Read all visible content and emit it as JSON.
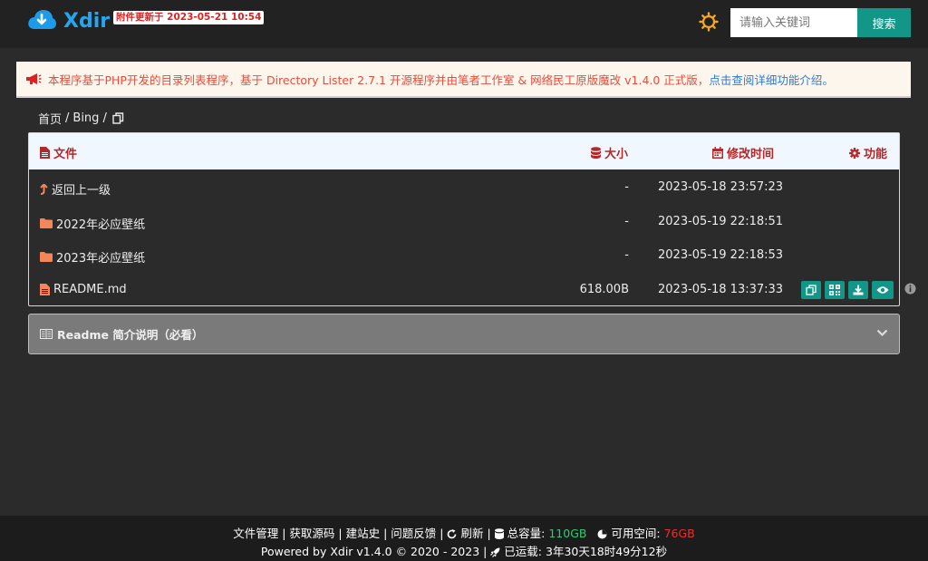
{
  "header": {
    "logo_text": "Xdir",
    "update_badge": "附件更新于 2023-05-21 10:54",
    "search": {
      "placeholder": "请输入关键词",
      "button": "搜索"
    }
  },
  "notice": {
    "text": "本程序基于PHP开发的目录列表程序，基于 Directory Lister 2.7.1 开源程序并由笔者工作室 & 网络民工原版魔改 v1.4.0 正式版，",
    "link": "点击查阅详细功能介绍。"
  },
  "breadcrumb": {
    "items": [
      "首页",
      "Bing"
    ],
    "separator": "/"
  },
  "table": {
    "columns": {
      "file": "文件",
      "size": "大小",
      "time": "修改时间",
      "func": "功能"
    },
    "rows": [
      {
        "name": "返回上一级",
        "icon": "up-arrow-icon",
        "size": "-",
        "time": "2023-05-18 23:57:23"
      },
      {
        "name": "2022年必应壁纸",
        "icon": "folder-icon",
        "size": "-",
        "time": "2023-05-19 22:18:51"
      },
      {
        "name": "2023年必应壁纸",
        "icon": "folder-icon",
        "size": "-",
        "time": "2023-05-19 22:18:53"
      },
      {
        "name": "README.md",
        "icon": "file-icon",
        "size": "618.00B",
        "time": "2023-05-18 13:37:33"
      }
    ],
    "actions": [
      "copy-icon",
      "qrcode-icon",
      "download-icon",
      "eye-icon"
    ]
  },
  "readme": {
    "label": "Readme 简介说明（必看）"
  },
  "footer": {
    "links": [
      "文件管理",
      "获取源码",
      "建站史",
      "问题反馈"
    ],
    "refresh": "刷新",
    "capacity_label": "总容量:",
    "capacity_value": "110GB",
    "free_label": "可用空间:",
    "free_value": "76GB",
    "powered": "Powered by Xdir v1.4.0 © 2020 - 2023 |",
    "uptime_label": "已运载:",
    "uptime_value": "3年30天18时49分12秒"
  },
  "colors": {
    "accent": "#119687",
    "logo": "#22a7f0",
    "header_th": "#b02a2a",
    "gear": "#f5a623",
    "folder": "#f4865a",
    "green": "#2ecc71",
    "red": "#e83030"
  }
}
